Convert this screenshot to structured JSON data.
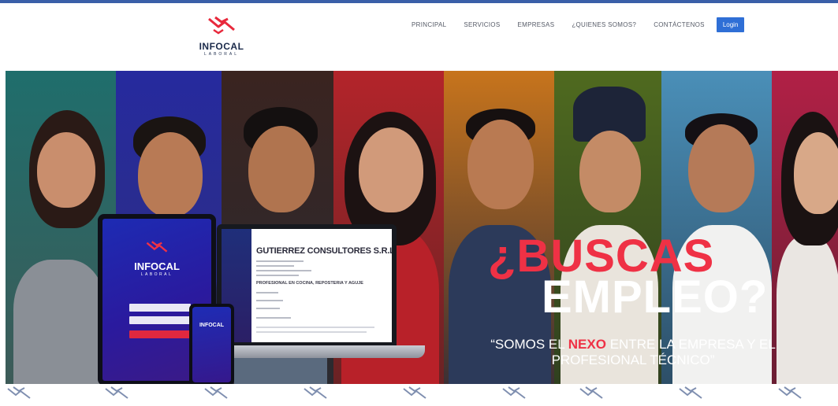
{
  "brand": {
    "name": "INFOCAL",
    "sub": "LABORAL",
    "accent": "#ef3145",
    "navy": "#1b2a4a",
    "login_color": "#2f6fd6"
  },
  "nav": {
    "items": [
      "PRINCIPAL",
      "SERVICIOS",
      "EMPRESAS",
      "¿QUIENES SOMOS?",
      "CONTÁCTENOS"
    ],
    "login_label": "Login"
  },
  "hero": {
    "headline_line1": "¿BUSCAS",
    "headline_line2": "EMPLEO?",
    "tagline_pre": "“SOMOS EL ",
    "tagline_highlight": "NEXO",
    "tagline_post": " ENTRE LA EMPRESA Y EL PROFESIONAL TÉCNICO”",
    "tablet_logo": "INFOCAL",
    "tablet_sub": "LABORAL",
    "phone_logo": "INFOCAL",
    "laptop_company": "GUTIERREZ CONSULTORES S.R.L.",
    "laptop_role": "PROFESIONAL EN COCINA, REPOSTERIA Y AGUJE"
  },
  "strip": {
    "icon": "handshake-icon",
    "count": 9
  }
}
